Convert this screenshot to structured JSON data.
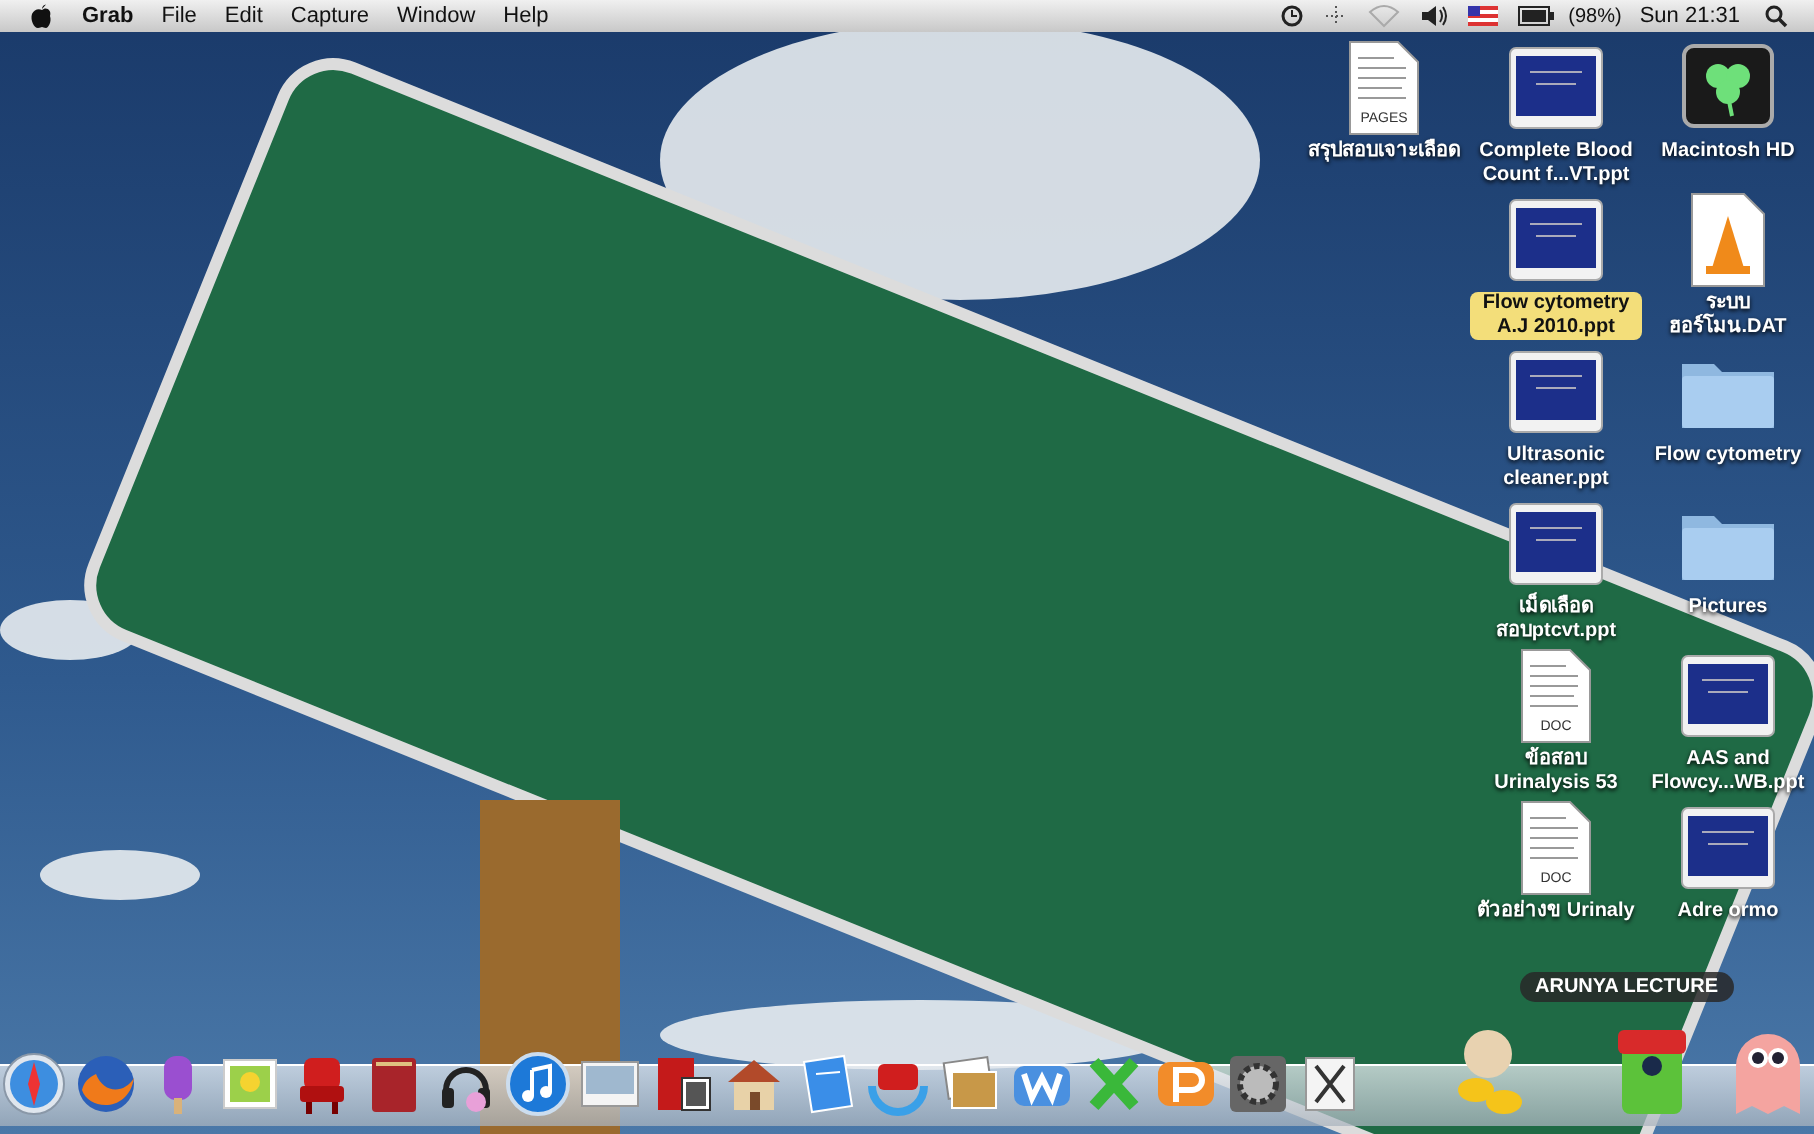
{
  "menu_bar": {
    "app": "Grab",
    "menus": [
      "File",
      "Edit",
      "Capture",
      "Window",
      "Help"
    ],
    "battery": "(98%)",
    "clock": "Sun 21:31"
  },
  "desktop": {
    "columns": [
      {
        "items": [
          {
            "label": "สรุปสอบเจาะเลือด",
            "kind": "document",
            "badge": "PAGES",
            "selected": false
          }
        ]
      },
      {
        "items": [
          {
            "label": "Complete Blood Count f...VT.ppt",
            "kind": "slide",
            "selected": false
          },
          {
            "label": "Flow cytometry A.J 2010.ppt",
            "kind": "slide",
            "selected": true
          },
          {
            "label": "Ultrasonic cleaner.ppt",
            "kind": "slide",
            "selected": false
          },
          {
            "label": "เม็ดเลือด สอบptcvt.ppt",
            "kind": "slide",
            "selected": false
          },
          {
            "label": "ข้อสอบ Urinalysis 53",
            "kind": "document",
            "badge": "DOC",
            "selected": false
          },
          {
            "label": "ตัวอย่างข Urinaly",
            "kind": "document",
            "badge": "DOC",
            "selected": false
          }
        ]
      },
      {
        "items": [
          {
            "label": "Macintosh HD",
            "kind": "disk",
            "selected": false
          },
          {
            "label": "ระบบฮอร์โมน.DAT",
            "kind": "cone",
            "selected": false
          },
          {
            "label": "Flow cytometry",
            "kind": "folder",
            "selected": false
          },
          {
            "label": "Pictures",
            "kind": "folder",
            "selected": false
          },
          {
            "label": "AAS and Flowcy...WB.ppt",
            "kind": "slide",
            "selected": false
          },
          {
            "label": "Adre ormo",
            "kind": "slide",
            "selected": false
          }
        ]
      }
    ]
  },
  "dock": {
    "tooltip": "ARUNYA LECTURE"
  }
}
